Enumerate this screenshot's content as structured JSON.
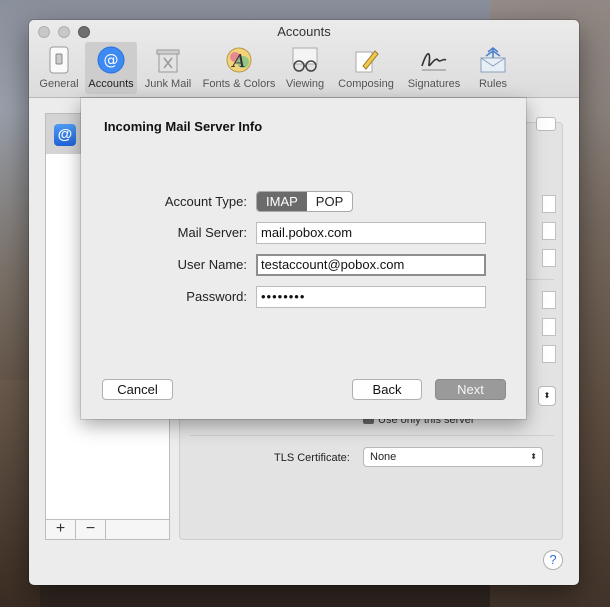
{
  "window": {
    "title": "Accounts"
  },
  "toolbar": {
    "items": [
      {
        "label": "General",
        "icon": "switch-icon"
      },
      {
        "label": "Accounts",
        "icon": "at-icon",
        "selected": true
      },
      {
        "label": "Junk Mail",
        "icon": "trash-icon"
      },
      {
        "label": "Fonts & Colors",
        "icon": "font-icon"
      },
      {
        "label": "Viewing",
        "icon": "glasses-icon"
      },
      {
        "label": "Composing",
        "icon": "pencil-icon"
      },
      {
        "label": "Signatures",
        "icon": "signature-icon"
      },
      {
        "label": "Rules",
        "icon": "rules-icon"
      }
    ]
  },
  "sidebar": {
    "account_icon": "@",
    "add_label": "+",
    "remove_label": "−"
  },
  "panel": {
    "use_only_server": "Use only this server",
    "tls_label": "TLS Certificate:",
    "tls_value": "None"
  },
  "sheet": {
    "title": "Incoming Mail Server Info",
    "account_type_label": "Account Type:",
    "account_type_options": [
      "IMAP",
      "POP"
    ],
    "account_type_selected": "IMAP",
    "mail_server_label": "Mail Server:",
    "mail_server_value": "mail.pobox.com",
    "user_name_label": "User Name:",
    "user_name_value": "testaccount@pobox.com",
    "password_label": "Password:",
    "password_value": "••••••••",
    "cancel_label": "Cancel",
    "back_label": "Back",
    "next_label": "Next"
  },
  "help": {
    "label": "?"
  },
  "colors": {
    "accent": "#2a6fe0",
    "selected_segment": "#6b6b6b",
    "disabled_button": "#9a9a9a"
  }
}
